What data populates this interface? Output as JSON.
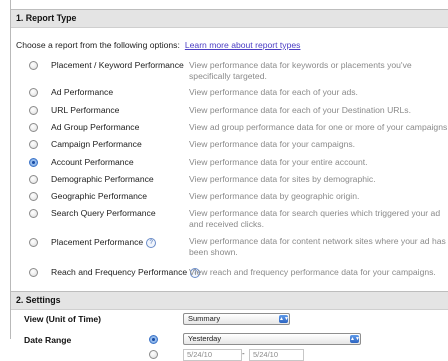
{
  "report_type": {
    "title": "1. Report Type",
    "choose_text": "Choose a report from the following options:",
    "learn_more_link": "Learn more about report types",
    "options": [
      {
        "label": "Placement / Keyword Performance",
        "description": "View performance data for keywords or placements you've specifically targeted.",
        "selected": false
      },
      {
        "label": "Ad Performance",
        "description": "View performance data for each of your ads.",
        "selected": false
      },
      {
        "label": "URL Performance",
        "description": "View performance data for each of your Destination URLs.",
        "selected": false
      },
      {
        "label": "Ad Group Performance",
        "description": "View ad group performance data for one or more of your campaigns.",
        "selected": false
      },
      {
        "label": "Campaign Performance",
        "description": "View performance data for your campaigns.",
        "selected": false
      },
      {
        "label": "Account Performance",
        "description": "View performance data for your entire account.",
        "selected": true
      },
      {
        "label": "Demographic Performance",
        "description": "View performance data for sites by demographic.",
        "selected": false
      },
      {
        "label": "Geographic Performance",
        "description": "View performance data by geographic origin.",
        "selected": false
      },
      {
        "label": "Search Query Performance",
        "description": "View performance data for search queries which triggered your ad and received clicks.",
        "selected": false
      },
      {
        "label": "Placement Performance",
        "description": "View performance data for content network sites where your ad has been shown.",
        "selected": false,
        "help": "?"
      },
      {
        "label": "Reach and Frequency Performance",
        "description": "View reach and frequency performance data for your campaigns.",
        "selected": false,
        "help": "?"
      }
    ]
  },
  "settings": {
    "title": "2. Settings",
    "view_label": "View (Unit of Time)",
    "view_value": "Summary",
    "date_range_label": "Date Range",
    "date_range_value": "Yesterday",
    "date_from": "5/24/10",
    "date_separator": "-",
    "date_to": "5/24/10"
  },
  "icons": {
    "select_arrow": "up-down-arrows-icon",
    "help": "question-mark-icon"
  },
  "colors": {
    "link": "#4a3dc3",
    "section_header_bg": "#e4e4e4",
    "description_text": "#8a8a8a",
    "radio_selected": "#1b4fa8"
  }
}
